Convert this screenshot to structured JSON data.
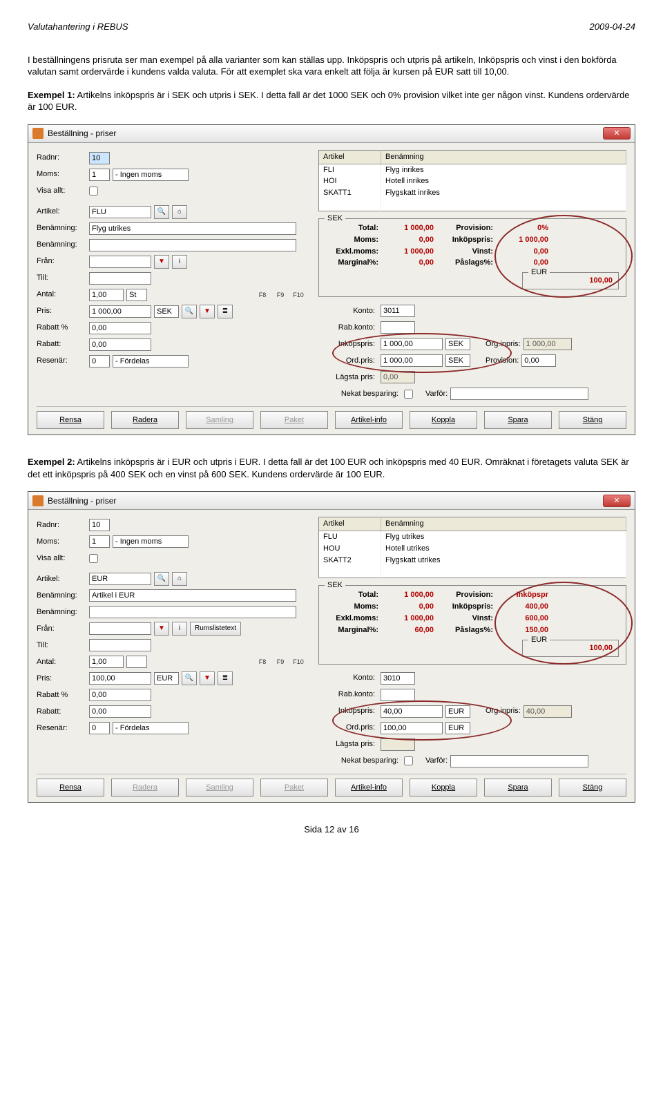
{
  "doc": {
    "header_left": "Valutahantering i REBUS",
    "header_right": "2009-04-24",
    "intro": "I beställningens prisruta ser man exempel på alla varianter som kan ställas upp. Inköpspris och utpris på artikeln, Inköpspris och vinst i den bokförda valutan samt ordervärde i kundens valda valuta. För att exemplet ska vara enkelt att följa är kursen på EUR satt till 10,00.",
    "ex1_label": "Exempel 1:",
    "ex1_text": " Artikelns inköpspris är i SEK och utpris i SEK. I detta fall är det 1000 SEK och 0% provision vilket inte ger någon vinst. Kundens ordervärde är 100 EUR.",
    "ex2_label": "Exempel 2:",
    "ex2_text": " Artikelns inköpspris är i EUR och utpris i EUR. I detta fall är det 100 EUR och inköpspris med 40 EUR. Omräknat i företagets valuta SEK är det ett inköpspris på 400 SEK och en vinst på 600 SEK. Kundens ordervärde är 100 EUR.",
    "footer": "Sida 12 av 16"
  },
  "dlg1": {
    "title": "Beställning - priser",
    "radnr_lbl": "Radnr:",
    "radnr": "10",
    "moms_lbl": "Moms:",
    "moms_code": "1",
    "moms_text": "- Ingen moms",
    "visa_lbl": "Visa allt:",
    "artikel_lbl": "Artikel:",
    "artikel": "FLU",
    "benamning_lbl": "Benämning:",
    "benamning": "Flyg utrikes",
    "benamning2_lbl": "Benämning:",
    "fran_lbl": "Från:",
    "till_lbl": "Till:",
    "antal_lbl": "Antal:",
    "antal": "1,00",
    "antal_unit": "St",
    "pris_lbl": "Pris:",
    "pris": "1 000,00",
    "pris_cur": "SEK",
    "rabattp_lbl": "Rabatt %",
    "rabattp": "0,00",
    "rabatt_lbl": "Rabatt:",
    "rabatt": "0,00",
    "resenar_lbl": "Resenär:",
    "resenar_code": "0",
    "resenar_text": "- Fördelas",
    "art_table_h1": "Artikel",
    "art_table_h2": "Benämning",
    "art_rows": [
      {
        "a": "FLI",
        "b": "Flyg inrikes"
      },
      {
        "a": "HOI",
        "b": "Hotell inrikes"
      },
      {
        "a": "SKATT1",
        "b": "Flygskatt inrikes"
      }
    ],
    "sek_legend": "SEK",
    "total_lbl": "Total:",
    "total": "1 000,00",
    "moms2_lbl": "Moms:",
    "moms2": "0,00",
    "exkl_lbl": "Exkl.moms:",
    "exkl": "1 000,00",
    "marg_lbl": "Marginal%:",
    "marg": "0,00",
    "prov_lbl": "Provision:",
    "prov": "0%",
    "inkop_lbl": "Inköpspris:",
    "inkop": "1 000,00",
    "vinst_lbl": "Vinst:",
    "vinst": "0,00",
    "paslag_lbl": "Påslags%:",
    "paslag": "0,00",
    "eur_legend": "EUR",
    "eur_val": "100,00",
    "konto_lbl": "Konto:",
    "konto": "3011",
    "rabkonto_lbl": "Rab.konto:",
    "inkopspris_lbl": "Inköpspris:",
    "inkopspris": "1 000,00",
    "inkopspris_cur": "SEK",
    "orgpris_lbl": "Org.inpris:",
    "orgpris": "1 000,00",
    "ordpris_lbl": "Ord.pris:",
    "ordpris": "1 000,00",
    "ordpris_cur": "SEK",
    "provision2_lbl": "Provision:",
    "provision2": "0,00",
    "lagsta_lbl": "Lägsta pris:",
    "lagsta": "0,00",
    "nekat_lbl": "Nekat besparing:",
    "varfor_lbl": "Varför:",
    "buttons": [
      "Rensa",
      "Radera",
      "Samling",
      "Paket",
      "Artikel-info",
      "Koppla",
      "Spara",
      "Stäng"
    ]
  },
  "dlg2": {
    "title": "Beställning - priser",
    "radnr": "10",
    "moms_code": "1",
    "moms_text": "- Ingen moms",
    "artikel": "EUR",
    "benamning": "Artikel i EUR",
    "antal": "1,00",
    "antal_unit": "",
    "pris": "100,00",
    "pris_cur": "EUR",
    "rabattp": "0,00",
    "rabatt": "0,00",
    "resenar_code": "0",
    "resenar_text": "- Fördelas",
    "rumsliste": "Rumslistetext",
    "art_rows": [
      {
        "a": "FLU",
        "b": "Flyg utrikes"
      },
      {
        "a": "HOU",
        "b": "Hotell utrikes"
      },
      {
        "a": "SKATT2",
        "b": "Flygskatt utrikes"
      }
    ],
    "total": "1 000,00",
    "moms2": "0,00",
    "exkl": "1 000,00",
    "marg": "60,00",
    "prov": "Inköpspr",
    "inkop": "400,00",
    "vinst": "600,00",
    "paslag": "150,00",
    "eur_val": "100,00",
    "konto": "3010",
    "inkopspris": "40,00",
    "inkopspris_cur": "EUR",
    "orgpris": "40,00",
    "ordpris": "100,00",
    "ordpris_cur": "EUR",
    "buttons": [
      "Rensa",
      "Radera",
      "Samling",
      "Paket",
      "Artikel-info",
      "Koppla",
      "Spara",
      "Stäng"
    ]
  }
}
